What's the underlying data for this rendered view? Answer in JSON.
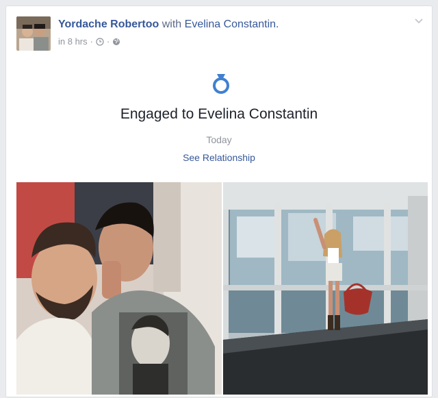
{
  "post": {
    "author": "Yordache Robertoo",
    "with_text": "with",
    "tagged": "Evelina Constantin.",
    "time": "in 8 hrs",
    "separator": "·",
    "avatar_icon": "profile-photo",
    "audience_icon": "globe-icon",
    "clock_icon": "clock-icon",
    "menu_icon": "chevron-down-icon"
  },
  "life_event": {
    "icon": "ring-icon",
    "title": "Engaged to Evelina Constantin",
    "date": "Today",
    "link": "See Relationship"
  },
  "colors": {
    "link": "#365899",
    "secondary_text": "#90949c",
    "primary_text": "#1d2129",
    "ring": "#4080d0",
    "page_bg": "#e9ebee"
  },
  "photos": [
    {
      "name": "selfie-photo"
    },
    {
      "name": "airport-photo"
    }
  ]
}
